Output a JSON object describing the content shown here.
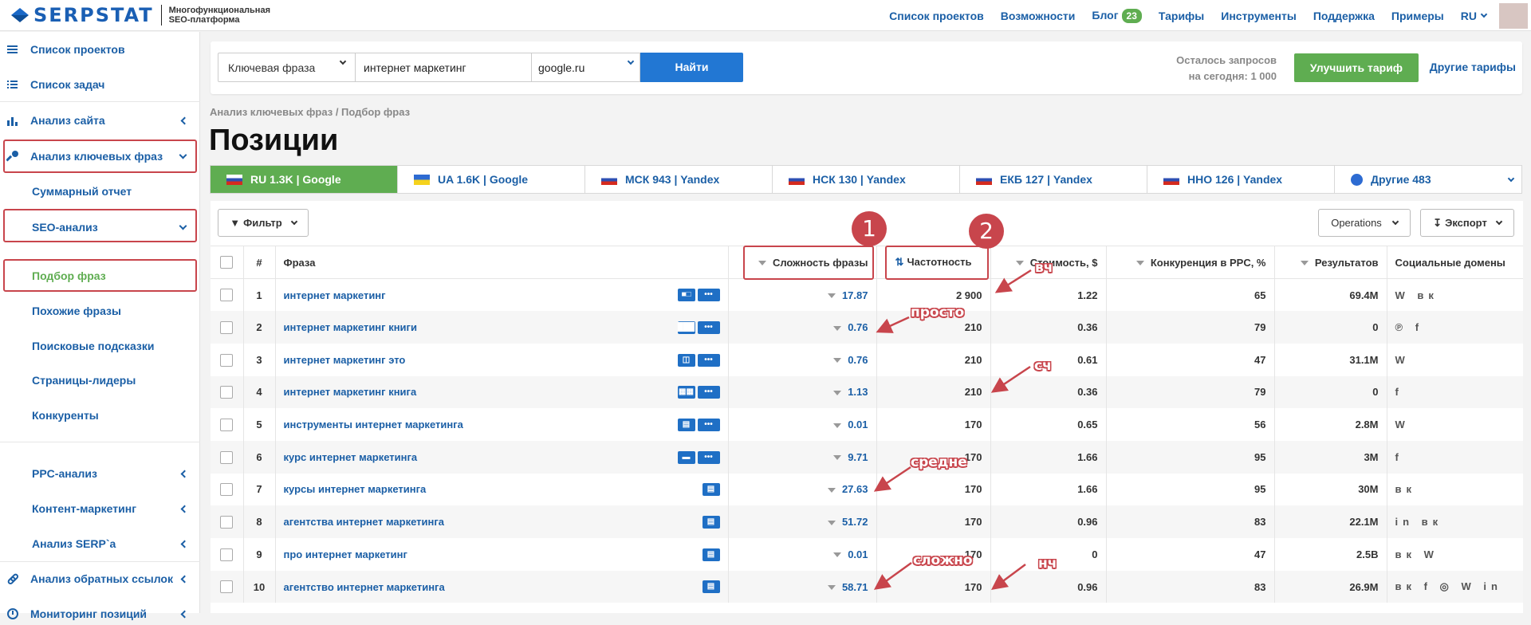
{
  "header": {
    "brand": "SERPSTAT",
    "tagline": "Многофункциональная SEO-платформа",
    "nav": [
      "Список проектов",
      "Возможности",
      "Блог",
      "Тарифы",
      "Инструменты",
      "Поддержка",
      "Примеры"
    ],
    "blog_badge": "23",
    "lang": "RU"
  },
  "sidebar": {
    "items": [
      {
        "label": "Список проектов",
        "icon": "list-icon"
      },
      {
        "label": "Список задач",
        "icon": "tasks-icon"
      },
      {
        "label": "Анализ сайта",
        "icon": "chart-icon"
      },
      {
        "label": "Анализ ключевых фраз",
        "icon": "key-icon"
      },
      {
        "label": "Суммарный отчет"
      },
      {
        "label": "SEO-анализ"
      },
      {
        "label": "Подбор фраз"
      },
      {
        "label": "Похожие фразы"
      },
      {
        "label": "Поисковые подсказки"
      },
      {
        "label": "Страницы-лидеры"
      },
      {
        "label": "Конкуренты"
      },
      {
        "label": "PPC-анализ"
      },
      {
        "label": "Контент-маркетинг"
      },
      {
        "label": "Анализ SERP`а"
      },
      {
        "label": "Анализ обратных ссылок",
        "icon": "link-icon"
      },
      {
        "label": "Мониторинг позиций",
        "icon": "monitor-icon"
      }
    ]
  },
  "search": {
    "type": "Ключевая фраза",
    "query": "интернет маркетинг",
    "db": "google.ru",
    "submit": "Найти",
    "remaining_label": "Осталось запросов",
    "remaining_today": "на сегодня: 1 000",
    "upgrade": "Улучшить тариф",
    "other": "Другие тарифы"
  },
  "breadcrumb": "Анализ ключевых фраз / Подбор фраз",
  "page_title": "Позиции",
  "regions": [
    "RU 1.3K | Google",
    "UA 1.6K | Google",
    "МСК 943 | Yandex",
    "НСК 130 | Yandex",
    "ЕКБ 127 | Yandex",
    "ННО 126 | Yandex",
    "Другие 483"
  ],
  "toolbar": {
    "filter": "Фильтр",
    "operations": "Operations",
    "export": "Экспорт"
  },
  "columns": {
    "num": "#",
    "phrase": "Фраза",
    "difficulty": "Сложность фразы",
    "frequency": "Частотность",
    "cost": "Стоимость, $",
    "competition": "Конкуренция в PPC, %",
    "results": "Результатов",
    "social": "Социальные домены"
  },
  "rows": [
    {
      "n": "1",
      "kw": "интернет маркетинг",
      "diff": "17.87",
      "freq": "2 900",
      "cost": "1.22",
      "comp": "65",
      "res": "69.4M",
      "social": "W вк"
    },
    {
      "n": "2",
      "kw": "интернет маркетинг книги",
      "diff": "0.76",
      "freq": "210",
      "cost": "0.36",
      "comp": "79",
      "res": "0",
      "social": "℗ f"
    },
    {
      "n": "3",
      "kw": "интернет маркетинг это",
      "diff": "0.76",
      "freq": "210",
      "cost": "0.61",
      "comp": "47",
      "res": "31.1M",
      "social": "W"
    },
    {
      "n": "4",
      "kw": "интернет маркетинг книга",
      "diff": "1.13",
      "freq": "210",
      "cost": "0.36",
      "comp": "79",
      "res": "0",
      "social": "f"
    },
    {
      "n": "5",
      "kw": "инструменты интернет маркетинга",
      "diff": "0.01",
      "freq": "170",
      "cost": "0.65",
      "comp": "56",
      "res": "2.8M",
      "social": "W"
    },
    {
      "n": "6",
      "kw": "курс интернет маркетинга",
      "diff": "9.71",
      "freq": "170",
      "cost": "1.66",
      "comp": "95",
      "res": "3M",
      "social": "f"
    },
    {
      "n": "7",
      "kw": "курсы интернет маркетинга",
      "diff": "27.63",
      "freq": "170",
      "cost": "1.66",
      "comp": "95",
      "res": "30M",
      "social": "вк"
    },
    {
      "n": "8",
      "kw": "агентства интернет маркетинга",
      "diff": "51.72",
      "freq": "170",
      "cost": "0.96",
      "comp": "83",
      "res": "22.1M",
      "social": "in вк"
    },
    {
      "n": "9",
      "kw": "про интернет маркетинг",
      "diff": "0.01",
      "freq": "170",
      "cost": "0",
      "comp": "47",
      "res": "2.5B",
      "social": "вк W"
    },
    {
      "n": "10",
      "kw": "агентство интернет маркетинга",
      "diff": "58.71",
      "freq": "170",
      "cost": "0.96",
      "comp": "83",
      "res": "26.9M",
      "social": "вк f ◎ W in"
    }
  ],
  "annotations": {
    "c1": "1",
    "c2": "2",
    "vch": "вч",
    "prosto": "просто",
    "sch": "сч",
    "sredne": "средне",
    "slozhno": "сложно",
    "nch": "нч"
  },
  "colors": {
    "accent": "#1b5fa6",
    "green": "#5fad51",
    "button": "#2277d3",
    "annotation": "#c8454c"
  }
}
